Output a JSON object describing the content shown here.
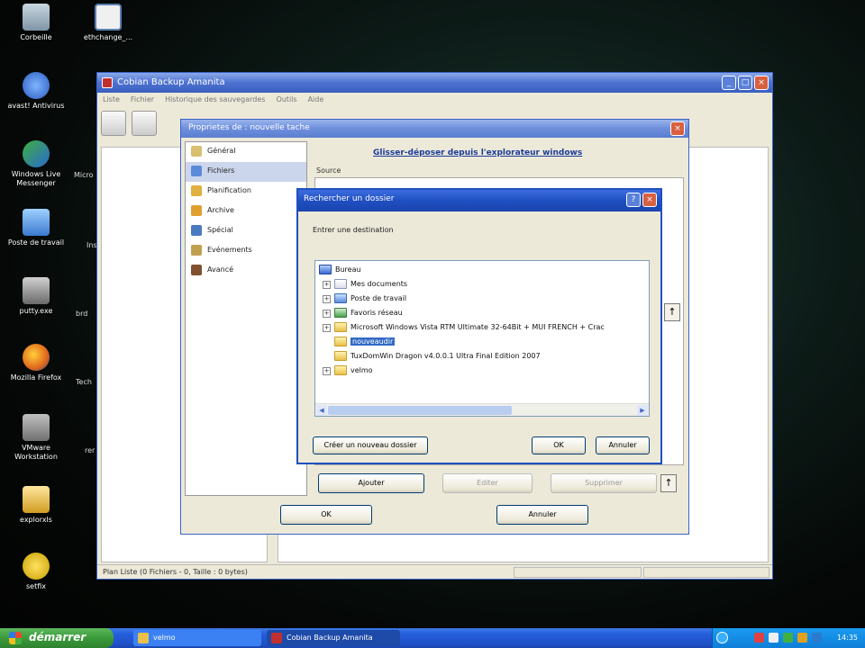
{
  "desktop": {
    "icons": [
      {
        "label": "Corbeille",
        "kind": "bin"
      },
      {
        "label": "ethchange_...",
        "kind": "file"
      },
      {
        "label": "avast! Antivirus",
        "kind": "avast"
      },
      {
        "label": "Windows Live Messenger",
        "kind": "msn"
      },
      {
        "label": "Poste de travail",
        "kind": "pc"
      },
      {
        "label": "putty.exe",
        "kind": "putty"
      },
      {
        "label": "Mozilla Firefox",
        "kind": "firefox"
      },
      {
        "label": "VMware Workstation",
        "kind": "vmware"
      },
      {
        "label": "explorxls",
        "kind": "explorer"
      },
      {
        "label": "setfix",
        "kind": "norton"
      }
    ],
    "partial_labels": [
      "Micro",
      "Ins",
      "brd",
      "Tech",
      "rer"
    ]
  },
  "main_window": {
    "title": "Cobian Backup Amanita",
    "menu": [
      "Liste",
      "Fichier",
      "Historique des sauvegardes",
      "Outils",
      "Aide"
    ],
    "status_text": "Plan Liste (0 Fichiers - 0, Taille : 0 bytes)",
    "controls": {
      "minimize": "_",
      "maximize": "□",
      "close": "×"
    }
  },
  "properties_dialog": {
    "title": "Proprietes de : nouvelle tache",
    "nav_items": [
      {
        "label": "Général",
        "icon": "general-icon",
        "color": "#d8c070"
      },
      {
        "label": "Fichiers",
        "icon": "files-icon",
        "color": "#5a8ad8",
        "selected": true
      },
      {
        "label": "Planification",
        "icon": "schedule-icon",
        "color": "#e0b040"
      },
      {
        "label": "Archive",
        "icon": "archive-icon",
        "color": "#e0a030"
      },
      {
        "label": "Spécial",
        "icon": "special-icon",
        "color": "#4a7ac0"
      },
      {
        "label": "Evénements",
        "icon": "events-icon",
        "color": "#c0a050"
      },
      {
        "label": "Avancé",
        "icon": "advanced-icon",
        "color": "#805030"
      }
    ],
    "link_text": "Glisser-déposer depuis l'explorateur windows",
    "source_label": "Source",
    "add_button": "Ajouter",
    "edit_button": "Editer",
    "remove_button": "Supprimer",
    "ok_button": "OK",
    "cancel_button": "Annuler",
    "close": "×"
  },
  "browse_dialog": {
    "title": "Rechercher un dossier",
    "prompt": "Entrer une destination",
    "help": "?",
    "close": "×",
    "tree": [
      {
        "label": "Bureau",
        "icon": "desk",
        "level": 0,
        "expander": ""
      },
      {
        "label": "Mes documents",
        "icon": "doc",
        "level": 1,
        "expander": "+"
      },
      {
        "label": "Poste de travail",
        "icon": "pc",
        "level": 1,
        "expander": "+"
      },
      {
        "label": "Favoris réseau",
        "icon": "net",
        "level": 1,
        "expander": "+"
      },
      {
        "label": "Microsoft Windows Vista RTM Ultimate 32-64Bit + MUI FRENCH + Crac",
        "icon": "folder",
        "level": 1,
        "expander": "+"
      },
      {
        "label": "nouveaudir",
        "icon": "folder",
        "level": 1,
        "expander": "",
        "selected": true
      },
      {
        "label": "TuxDomWin Dragon v4.0.0.1 Ultra Final Edition 2007",
        "icon": "folder",
        "level": 1,
        "expander": ""
      },
      {
        "label": "velmo",
        "icon": "folder",
        "level": 1,
        "expander": "+"
      }
    ],
    "new_folder_button": "Créer un nouveau dossier",
    "ok_button": "OK",
    "cancel_button": "Annuler"
  },
  "taskbar": {
    "start_label": "démarrer",
    "tasks": [
      {
        "label": "velmo"
      },
      {
        "label": "Cobian Backup Amanita"
      }
    ],
    "clock": "14:35"
  }
}
